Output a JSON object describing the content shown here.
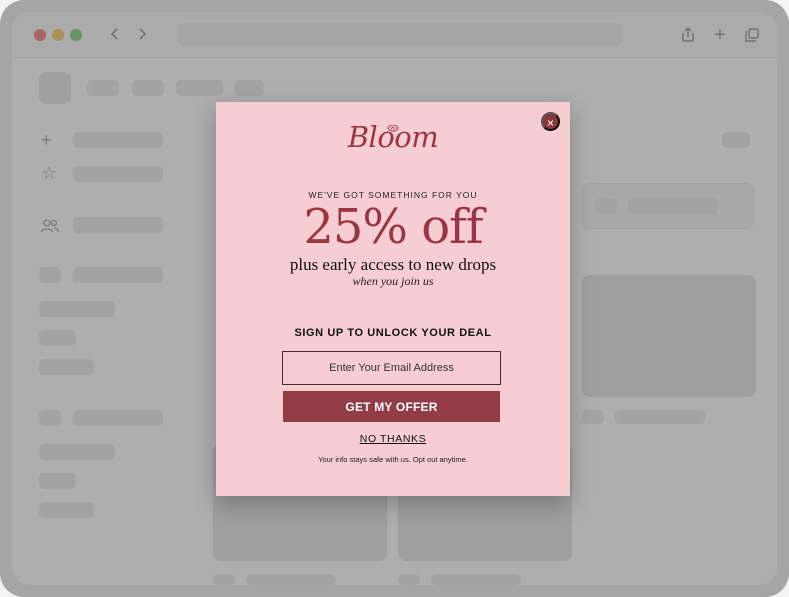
{
  "colors": {
    "brand": "#9a3644",
    "modal_bg": "#f5cdd3",
    "cta_bg": "#923c45",
    "close_bg": "#8a3a3f"
  },
  "browser": {
    "icons": [
      "back-icon",
      "forward-icon",
      "share-icon",
      "plus-icon",
      "tabs-icon"
    ]
  },
  "modal": {
    "brand": "Bloom",
    "kicker": "WE'VE GOT SOMETHING FOR YOU",
    "headline": "25% off",
    "subhead": "plus early access to new drops",
    "subsub": "when you join us",
    "signup_heading": "SIGN UP TO UNLOCK YOUR DEAL",
    "email_placeholder": "Enter Your Email Address",
    "cta_label": "GET MY OFFER",
    "decline_label": "NO THANKS",
    "fineprint": "Your info stays safe with us. Opt out anytime.",
    "close_symbol": "×"
  }
}
